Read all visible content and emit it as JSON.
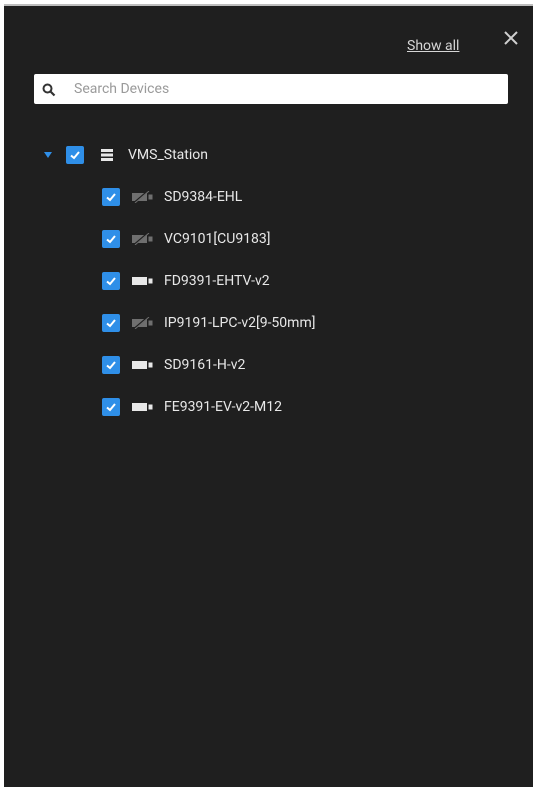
{
  "panel": {
    "show_all_label": "Show all",
    "close_icon": "close-icon"
  },
  "search": {
    "placeholder": "Search Devices",
    "value": "",
    "icon": "search-icon"
  },
  "tree": {
    "root": {
      "label": "VMS_Station",
      "expanded": true,
      "checked": true,
      "icon": "server-icon"
    },
    "devices": [
      {
        "label": "SD9384-EHL",
        "checked": true,
        "icon": "camera-offline-icon"
      },
      {
        "label": "VC9101[CU9183]",
        "checked": true,
        "icon": "camera-offline-icon"
      },
      {
        "label": "FD9391-EHTV-v2",
        "checked": true,
        "icon": "camera-icon"
      },
      {
        "label": "IP9191-LPC-v2[9-50mm]",
        "checked": true,
        "icon": "camera-offline-icon"
      },
      {
        "label": "SD9161-H-v2",
        "checked": true,
        "icon": "camera-icon"
      },
      {
        "label": "FE9391-EV-v2-M12",
        "checked": true,
        "icon": "camera-icon"
      }
    ]
  },
  "colors": {
    "panel_bg": "#1f1f1f",
    "accent": "#2f8fe8",
    "text": "#e8e8e8",
    "offline_icon": "#6f6f6f"
  }
}
